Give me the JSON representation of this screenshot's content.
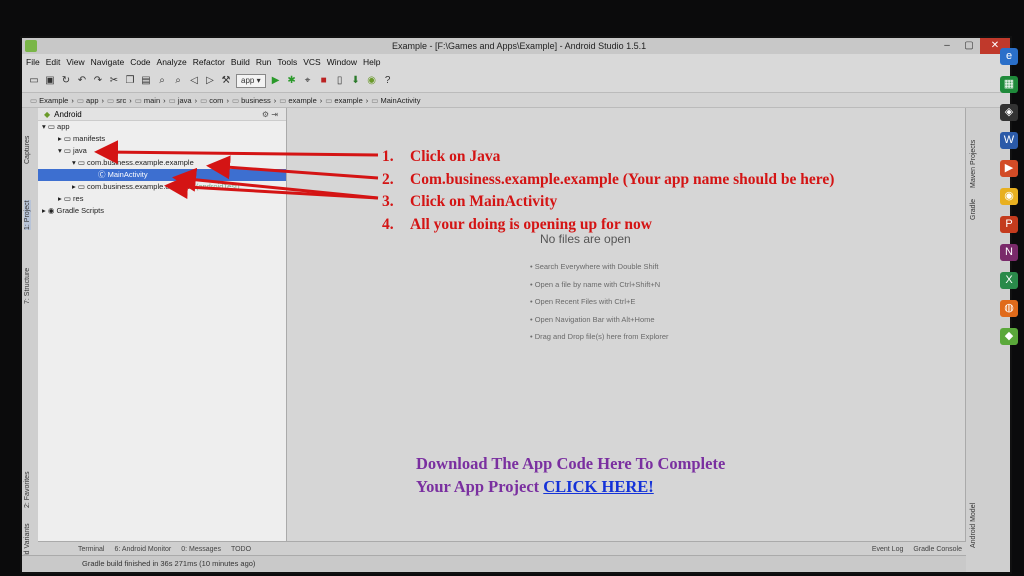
{
  "window": {
    "title": "Example - [F:\\Games and Apps\\Example] - Android Studio 1.5.1"
  },
  "menu": [
    "File",
    "Edit",
    "View",
    "Navigate",
    "Code",
    "Analyze",
    "Refactor",
    "Build",
    "Run",
    "Tools",
    "VCS",
    "Window",
    "Help"
  ],
  "toolbar": {
    "run_config": "app"
  },
  "breadcrumbs": [
    "Example",
    "app",
    "src",
    "main",
    "java",
    "com",
    "business",
    "example",
    "example",
    "MainActivity"
  ],
  "project_panel": {
    "view_selector": "Android",
    "tree": [
      {
        "label": "app",
        "indent": 0
      },
      {
        "label": "manifests",
        "indent": 1
      },
      {
        "label": "java",
        "indent": 1
      },
      {
        "label": "com.business.example.example",
        "indent": 2
      },
      {
        "label": "MainActivity",
        "indent": 3,
        "selected": true
      },
      {
        "label": "com.business.example.example",
        "suffix": "(androidTest)",
        "indent": 2
      },
      {
        "label": "res",
        "indent": 1
      },
      {
        "label": "Gradle Scripts",
        "indent": 0
      }
    ]
  },
  "left_tool_labels": [
    "Captures",
    "1: Project",
    "7: Structure",
    "2: Favorites",
    "Build Variants"
  ],
  "right_tool_labels": [
    "Maven Projects",
    "Gradle",
    "Android Model"
  ],
  "editor": {
    "empty_title": "No files are open",
    "hints": [
      "• Search Everywhere with Double Shift",
      "• Open a file by name with Ctrl+Shift+N",
      "• Open Recent Files with Ctrl+E",
      "• Open Navigation Bar with Alt+Home",
      "• Drag and Drop file(s) here from Explorer"
    ]
  },
  "bottom_tabs": [
    "Terminal",
    "6: Android Monitor",
    "0: Messages",
    "TODO"
  ],
  "bottom_right_tabs": [
    "Event Log",
    "Gradle Console"
  ],
  "status": "Gradle build finished in 36s 271ms (10 minutes ago)",
  "annotations": {
    "instructions": [
      {
        "num": "1.",
        "text": "Click on Java"
      },
      {
        "num": "2.",
        "text": "Com.business.example.example (Your app name should be here)"
      },
      {
        "num": "3.",
        "text": "Click on MainActivity"
      },
      {
        "num": "4.",
        "text": "All your doing is opening up for now"
      }
    ],
    "download_line1": "Download The App Code Here To Complete",
    "download_line2": "Your App Project",
    "download_link": "CLICK HERE!",
    "colors": {
      "instructions": "#d41414",
      "download": "#7a2fa0",
      "link": "#1432d8"
    }
  }
}
